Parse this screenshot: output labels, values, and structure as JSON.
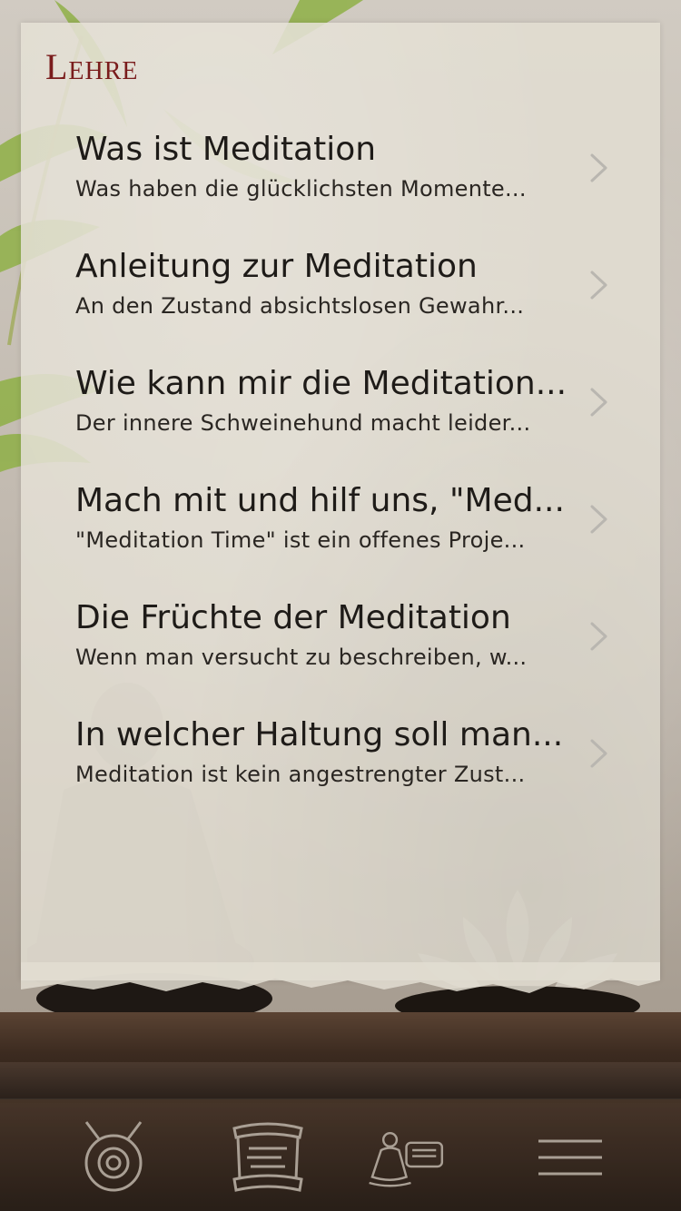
{
  "screen": {
    "section_title": "Lehre"
  },
  "list": {
    "items": [
      {
        "title": "Was ist Meditation",
        "subtitle": "Was haben die glücklichsten Momente..."
      },
      {
        "title": "Anleitung zur Meditation",
        "subtitle": "An den Zustand absichtslosen Gewahr..."
      },
      {
        "title": "Wie kann mir die Meditation...",
        "subtitle": "Der innere Schweinehund macht leider..."
      },
      {
        "title": "Mach mit und hilf uns, \"Med...",
        "subtitle": "\"Meditation Time\" ist ein offenes Proje..."
      },
      {
        "title": "Die Früchte der Meditation",
        "subtitle": "Wenn man versucht zu beschreiben, w..."
      },
      {
        "title": "In welcher Haltung soll man...",
        "subtitle": "Meditation ist kein angestrengter Zust..."
      }
    ]
  },
  "tabbar": {
    "tabs": [
      {
        "icon": "gong-icon"
      },
      {
        "icon": "scroll-icon"
      },
      {
        "icon": "buddha-chat-icon"
      },
      {
        "icon": "menu-icon"
      }
    ]
  },
  "colors": {
    "section_title": "#7a1c1c",
    "text": "#1e1b18",
    "chevron": "#b9b6b0",
    "tab_icon": "#a99f94"
  }
}
